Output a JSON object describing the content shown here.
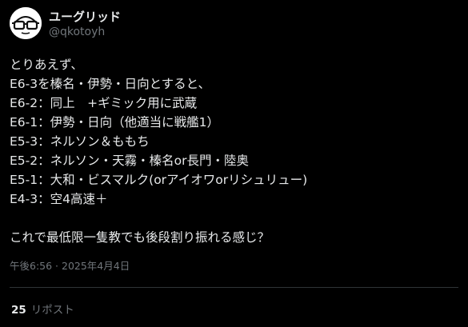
{
  "user": {
    "display_name": "ユーグリッド",
    "handle": "@qkotoyh",
    "avatar_icon": "glasses-face-icon"
  },
  "tweet": {
    "lines": [
      "とりあえず、",
      "E6-3を榛名・伊勢・日向とすると、",
      "E6-2：同上　+ギミック用に武蔵",
      "E6-1：伊勢・日向（他適当に戦艦1）",
      "E5-3：ネルソン＆ももち",
      "E5-2：ネルソン・天霧・榛名or長門・陸奥",
      "E5-1：大和・ビスマルク(orアイオワorリシュリュー)",
      "E4-3：空4高速＋",
      "",
      "これで最低限一隻教でも後段割り振れる感じ？"
    ],
    "timestamp": "午後6:56 · 2025年4月4日"
  },
  "stats": {
    "repost_count": "25",
    "repost_label": "リポスト"
  },
  "colors": {
    "background": "#000000",
    "primary_text": "#e7e9ea",
    "secondary_text": "#71767b",
    "divider": "#2f3336"
  }
}
